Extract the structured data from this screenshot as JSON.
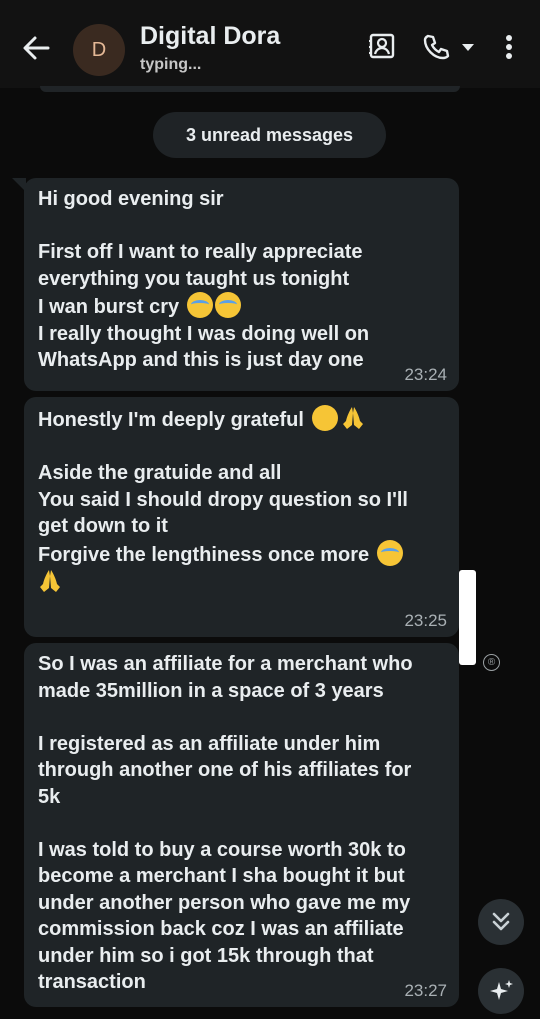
{
  "header": {
    "contact_name": "Digital Dora",
    "status": "typing...",
    "avatar_letter": "D",
    "icons": [
      "back-arrow-icon",
      "contact-card-icon",
      "phone-icon",
      "dropdown-icon",
      "more-icon"
    ]
  },
  "unread_label": "3 unread messages",
  "messages": [
    {
      "lines": [
        "Hi good evening sir",
        "",
        "First off I want to really appreciate",
        "everything you taught us tonight",
        "I wan burst cry",
        "I really thought I was doing well on",
        "WhatsApp and this is just day one"
      ],
      "time": "23:24"
    },
    {
      "lines": [
        "Honestly I'm deeply grateful",
        "",
        "Aside the gratuide and all",
        "You said I should dropy question so I'll",
        "get down to it",
        "Forgive the lengthiness once more"
      ],
      "time": "23:25"
    },
    {
      "lines": [
        "So I was an affiliate for a merchant who",
        "made 35million in a space of 3 years",
        "",
        "I registered as an affiliate under him",
        "through another one of his affiliates for",
        "5k",
        "",
        "I was told to buy a course worth 30k to",
        "become a merchant I sha bought it but",
        "under another person who gave me my",
        "commission back coz I was an affiliate",
        "under him so i got 15k through that",
        "transaction"
      ],
      "time": "23:27"
    }
  ],
  "side": {
    "registered_mark": "®"
  },
  "colors": {
    "bubble": "#1f2427",
    "background": "#0b0b0b",
    "header": "#121212"
  }
}
